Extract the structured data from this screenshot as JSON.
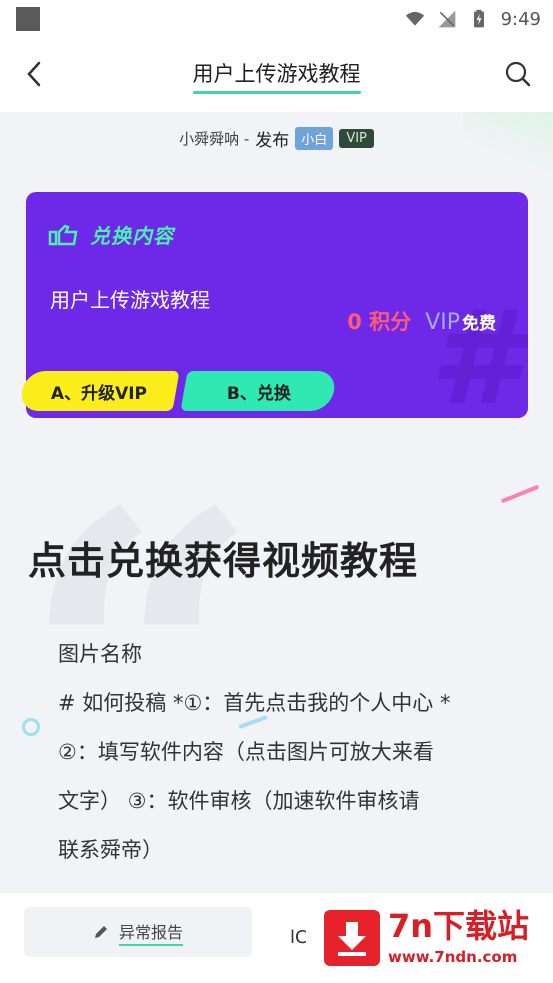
{
  "status_bar": {
    "time": "9:49"
  },
  "app_bar": {
    "title": "用户上传游戏教程"
  },
  "publisher": {
    "name": "小舜舜呐 -",
    "action": "发布",
    "level_badge": "小白",
    "vip_badge": "VIP"
  },
  "card": {
    "header": "兑换内容",
    "subtitle": "用户上传游戏教程",
    "points": "0 积分",
    "vip": "VIP",
    "vip_free": "免费",
    "btn_upgrade": "A、升级VIP",
    "btn_redeem": "B、兑换",
    "colors": {
      "background": "#6e28e8",
      "upgrade": "#fbee1a",
      "redeem": "#2fe8b2",
      "points": "#ff5a76"
    }
  },
  "article": {
    "title": "点击兑换获得视频教程",
    "lines": [
      "图片名称",
      "# 如何投稿 *①：首先点击我的个人中心 *",
      " ②：填写软件内容（点击图片可放大来看",
      "文字） ③：软件审核（加速软件审核请",
      "联系舜帝）"
    ]
  },
  "bottom_bar": {
    "report_label": "异常报告",
    "partial_label": "lC"
  },
  "watermark": {
    "main": "7n下载站",
    "sub": "www.7ndn.com"
  },
  "icons": {
    "back": "back-arrow-icon",
    "search": "search-icon",
    "pencil": "pencil-icon",
    "download": "download-arrow-icon"
  }
}
